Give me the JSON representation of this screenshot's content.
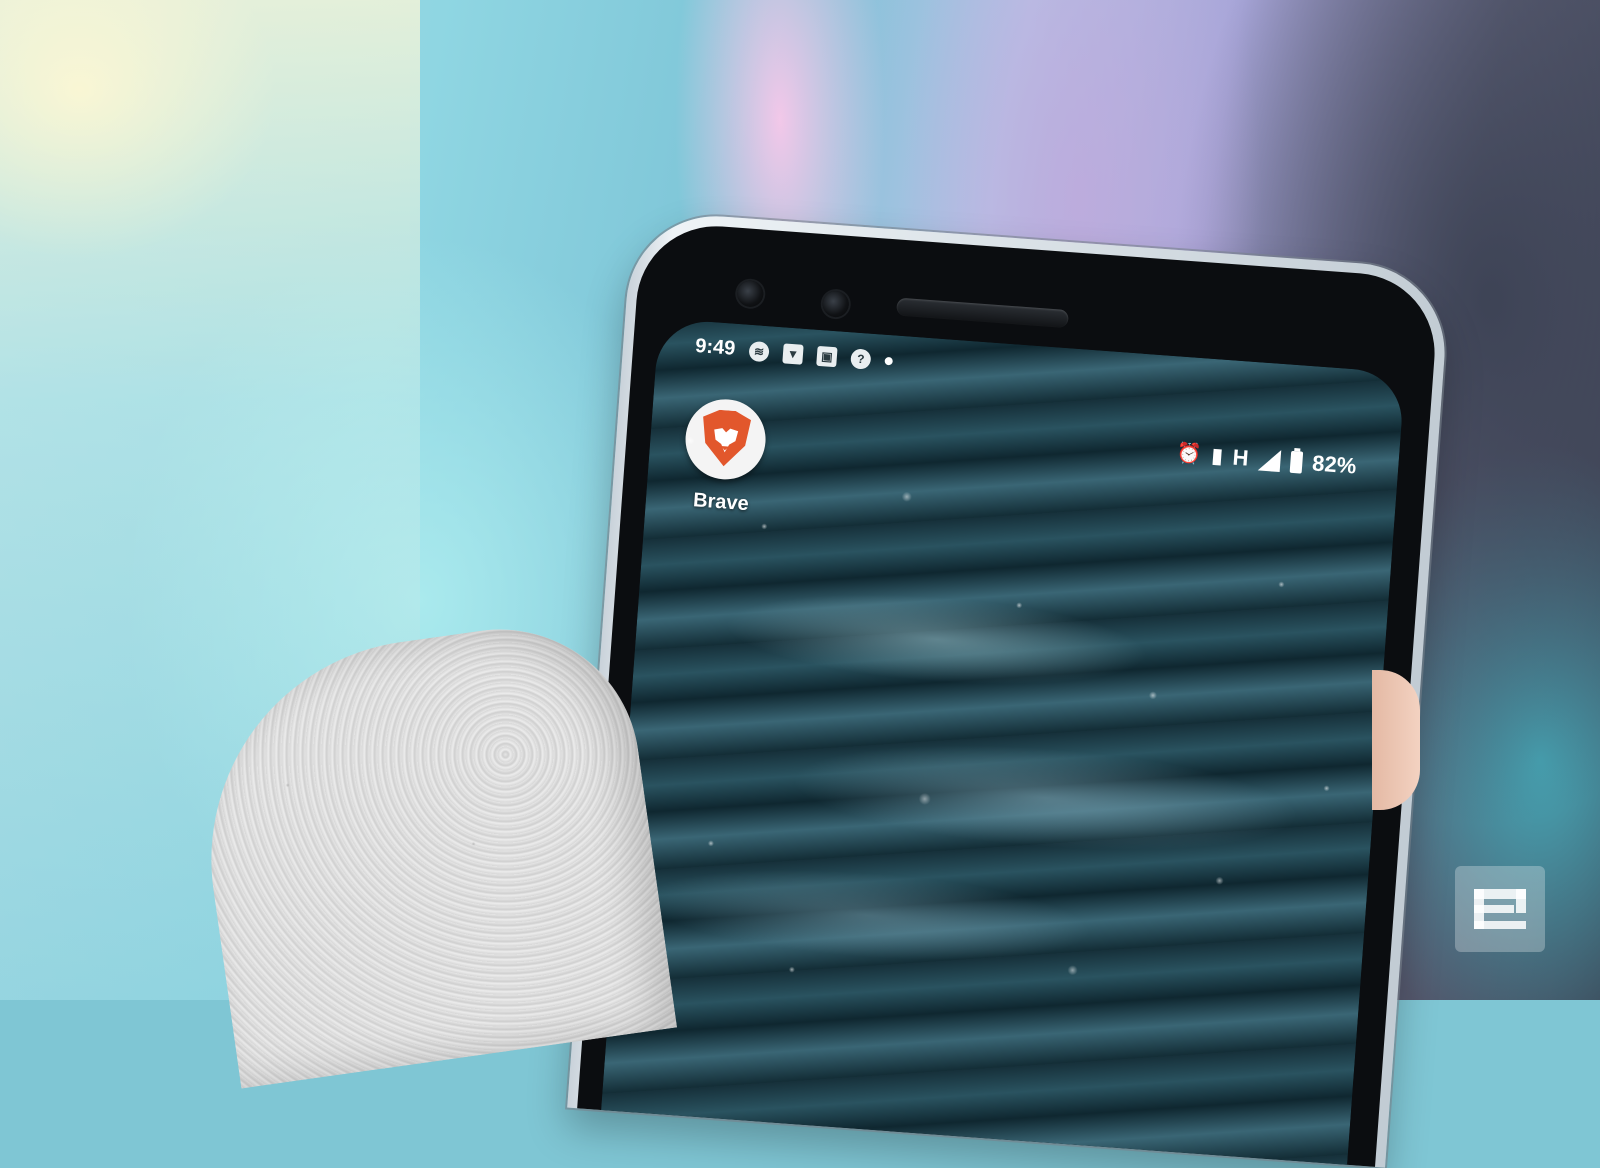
{
  "status_bar": {
    "time": "9:49",
    "left_icons": [
      "spotify-icon",
      "brave-icon",
      "screenshot-icon",
      "wifi-question-icon",
      "notification-dot-icon"
    ],
    "right_icons": [
      "alarm-icon",
      "vibrate-icon",
      "network-h-icon",
      "signal-icon",
      "battery-icon"
    ],
    "network_type": "H",
    "battery": "82%"
  },
  "home_screen": {
    "apps": [
      {
        "label": "Brave",
        "icon": "brave-lion-icon",
        "color": "#e2572c"
      }
    ]
  },
  "watermark": {
    "icon": "engadget-logo-icon"
  }
}
